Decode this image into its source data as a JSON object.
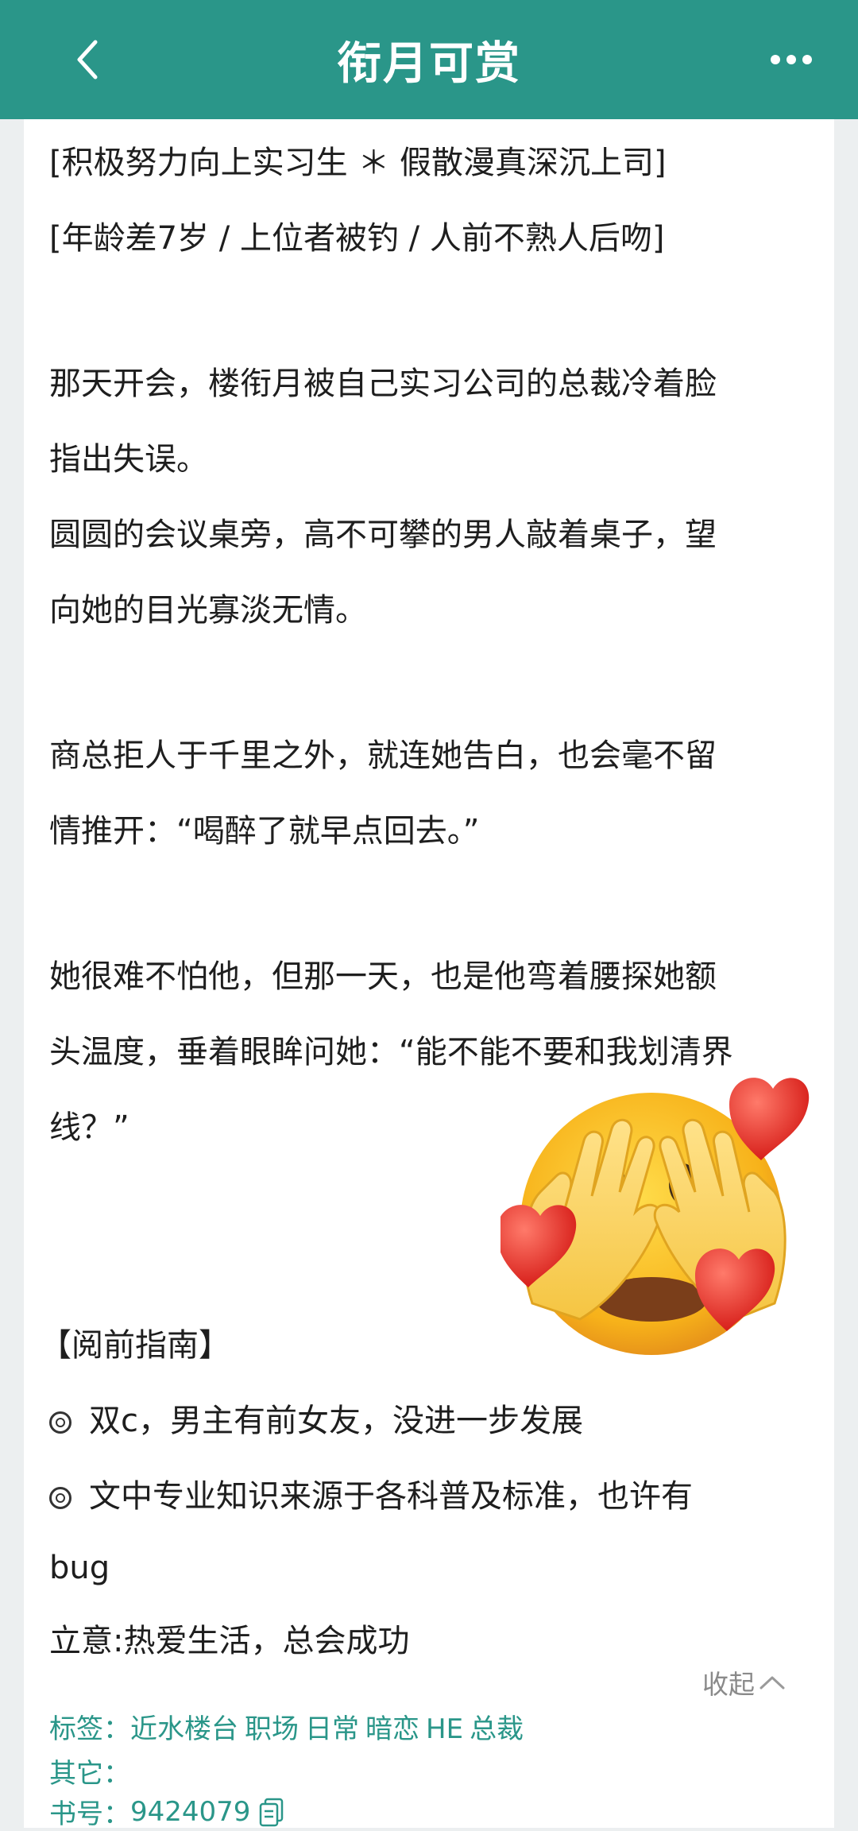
{
  "header": {
    "title": "衔月可赏",
    "back_icon": "chevron-left-icon",
    "more_icon": "more-dots-icon",
    "background": "#2a9689"
  },
  "summary": {
    "lines": [
      "[积极努力向上实习生 ＊ 假散漫真深沉上司]",
      "[年龄差7岁 / 上位者被钓 / 人前不熟人后吻]",
      "那天开会，楼衔月被自己实习公司的总裁冷着脸",
      "指出失误。",
      "圆圆的会议桌旁，高不可攀的男人敲着桌子，望",
      "向她的目光寡淡无情。",
      "商总拒人于千里之外，就连她告白，也会毫不留",
      "情推开：“喝醉了就早点回去。”",
      "她很难不怕他，但那一天，也是他弯着腰探她额",
      "头温度，垂着眼眸问她：“能不能不要和我划清界",
      "线？”"
    ]
  },
  "guide": {
    "heading": "【阅前指南】",
    "bullet_icon": "double-circle-bullet-icon",
    "items": [
      "双c，男主有前女友，没进一步发展",
      "文中专业知识来源于各科普及标准，也许有"
    ],
    "continuation": "bug",
    "theme": "立意:热爱生活，总会成功"
  },
  "collapse": {
    "label": "收起",
    "icon": "chevron-up-icon"
  },
  "meta": {
    "tags_label": "标签：",
    "tags": [
      "近水楼台",
      "职场",
      "日常",
      "暗恋",
      "HE",
      "总裁"
    ],
    "other_label": "其它：",
    "book_label": "书号：",
    "book_number": "9424079",
    "copy_icon": "copy-icon",
    "accent": "#2a9689"
  },
  "sticker": {
    "icon": "face-peeking-through-hands-with-hearts-emoji"
  }
}
